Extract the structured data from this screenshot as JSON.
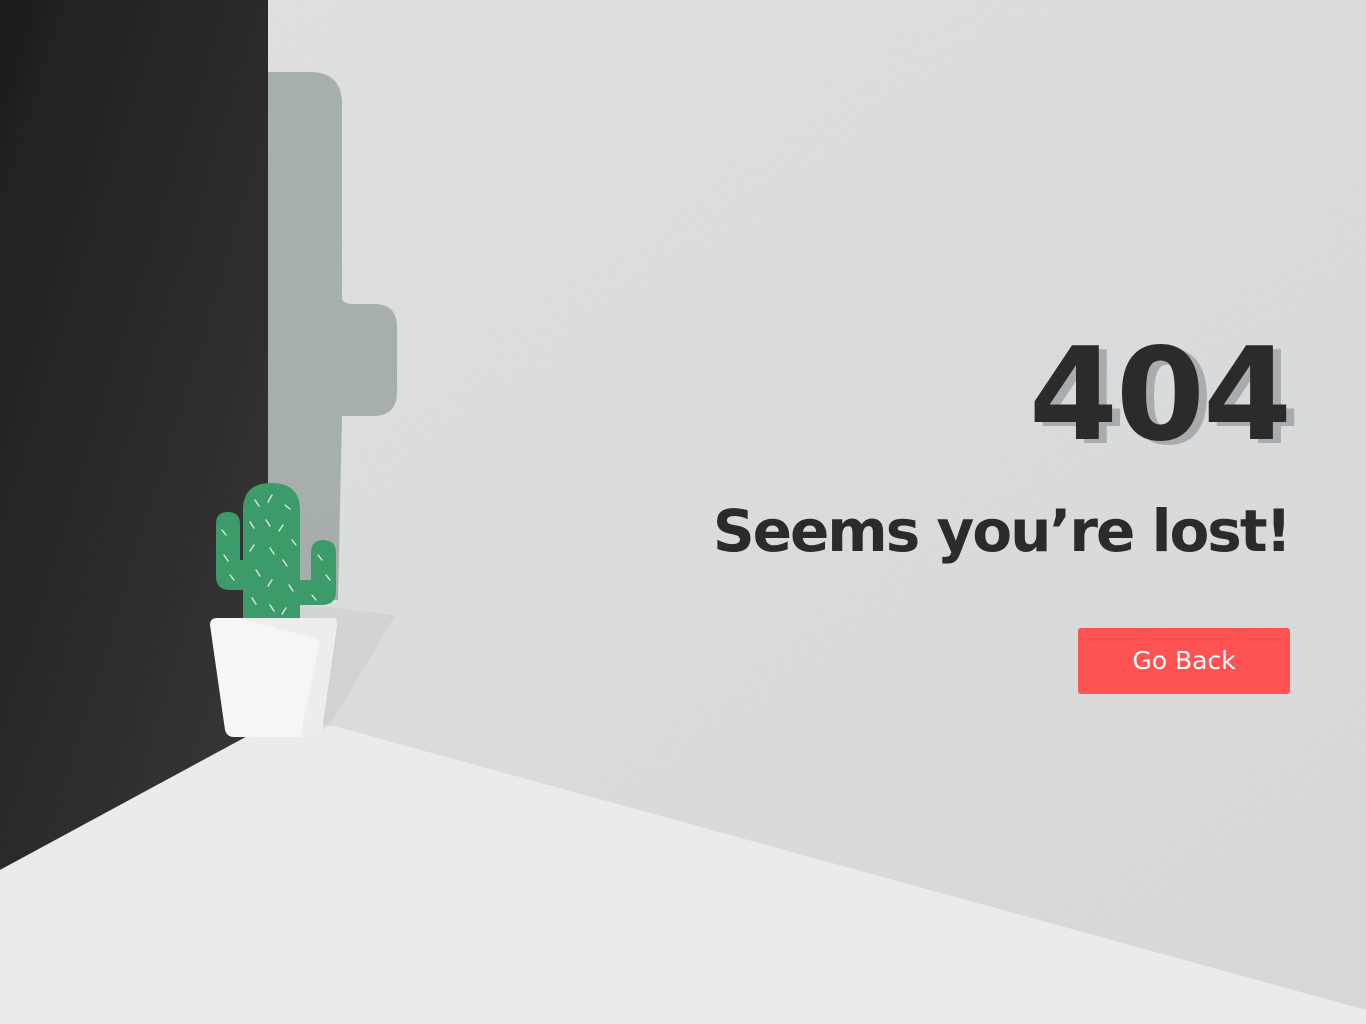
{
  "error_page": {
    "code": "404",
    "message": "Seems you’re lost!",
    "back_button_label": "Go Back"
  },
  "colors": {
    "accent": "#ff5252",
    "text": "#2b2b2c",
    "wall_dark": "#2a2a2a",
    "wall_light": "#e4e5e6",
    "floor": "#f3f3f3",
    "cactus": "#3d9a6a",
    "cactus_shadow": "#9ca6a3",
    "pot": "#f6f6f6"
  },
  "icons": {
    "illustration": "cactus-in-pot-icon"
  }
}
